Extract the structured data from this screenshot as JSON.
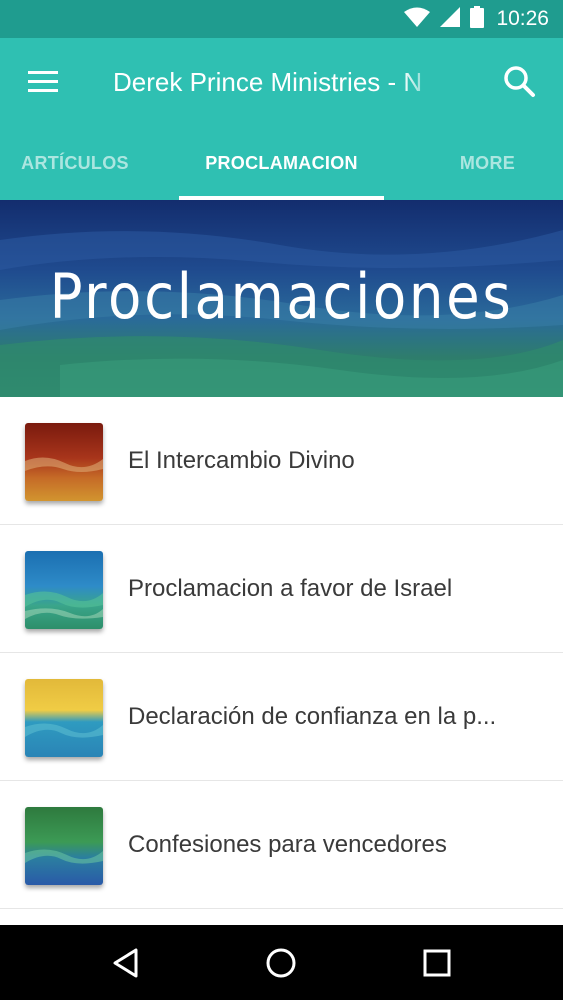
{
  "status_bar": {
    "time": "10:26",
    "icons": [
      "wifi-icon",
      "signal-icon",
      "battery-icon"
    ]
  },
  "toolbar": {
    "title": "Derek Prince Ministries - N",
    "menu_icon": "menu-icon",
    "search_icon": "search-icon"
  },
  "tabs": [
    {
      "label": "ARTÍCULOS",
      "active": false
    },
    {
      "label": "PROCLAMACION",
      "active": true
    },
    {
      "label": "MORE",
      "active": false
    }
  ],
  "banner": {
    "title": "Proclamaciones"
  },
  "list": {
    "items": [
      {
        "label": "El Intercambio Divino"
      },
      {
        "label": "Proclamacion a favor de Israel"
      },
      {
        "label": "Declaración de confianza en la p..."
      },
      {
        "label": "Confesiones para vencedores"
      }
    ]
  },
  "nav_bar": {
    "icons": [
      "back-icon",
      "home-icon",
      "recents-icon"
    ]
  },
  "colors": {
    "status_bar": "#1f9c8f",
    "app_bar": "#2fc0b2",
    "nav_bar": "#000000",
    "list_text": "#3a3a3a"
  }
}
